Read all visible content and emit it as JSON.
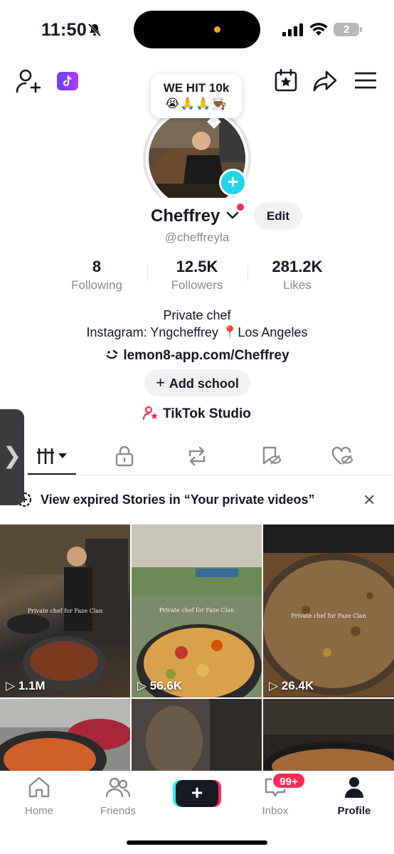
{
  "status_bar": {
    "time": "11:50",
    "battery": "2"
  },
  "story_bubble": {
    "line1": "WE HIT 10k",
    "line2": "😭🙏🙏👨🏾‍🍳"
  },
  "profile": {
    "name": "Cheffrey",
    "edit_label": "Edit",
    "handle": "@cheffreyla"
  },
  "stats": [
    {
      "value": "8",
      "label": "Following"
    },
    {
      "value": "12.5K",
      "label": "Followers"
    },
    {
      "value": "281.2K",
      "label": "Likes"
    }
  ],
  "bio": {
    "line1": "Private chef",
    "line2": "Instagram: Yngcheffrey 📍Los Angeles"
  },
  "link": "lemon8-app.com/Cheffrey",
  "add_school_label": "Add school",
  "studio_label": "TikTok Studio",
  "expired_stories": "View expired Stories in “Your private videos”",
  "videos": [
    {
      "views": "1.1M",
      "caption": "Private chef for Faze Clan"
    },
    {
      "views": "56.6K",
      "caption": "Private chef for Faze Clan"
    },
    {
      "views": "26.4K",
      "caption": "Private chef for Faze Clan"
    },
    {
      "views": "",
      "caption": ""
    },
    {
      "views": "",
      "caption": ""
    },
    {
      "views": "",
      "caption": ""
    }
  ],
  "nav": {
    "home": "Home",
    "friends": "Friends",
    "inbox": "Inbox",
    "inbox_badge": "99+",
    "profile": "Profile"
  },
  "colors": {
    "accent_cyan": "#20d5ec",
    "accent_red": "#fe2c55",
    "tiktok_purple": "#8b3dff"
  }
}
